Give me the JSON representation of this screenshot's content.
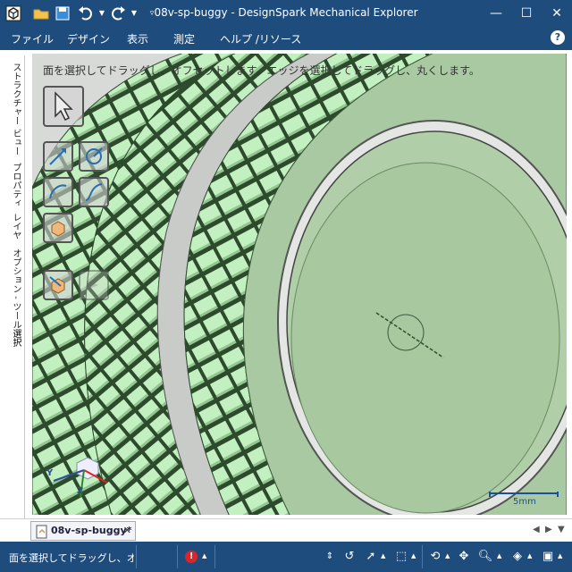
{
  "window": {
    "title": "08v-sp-buggy - DesignSpark Mechanical Explorer",
    "minimize_glyph": "—",
    "maximize_glyph": "☐",
    "close_glyph": "✕"
  },
  "menu": {
    "items": [
      "ファイル",
      "デザイン",
      "表示",
      "測定",
      "ヘルプ /リソース"
    ],
    "help_glyph": "?"
  },
  "side_panel": {
    "tabs": [
      "ストラクチャー",
      "ビュー",
      "プロパティ",
      "レイヤ",
      "オプション - ツール",
      "選択"
    ]
  },
  "viewport": {
    "hint": "面を選択してドラッグし、オフセットします。エッジを選択してドラッグし、丸くします。",
    "scale_label": "5mm",
    "axes": {
      "y": "Y",
      "z": "Z"
    },
    "colors": {
      "tread": "#c3f0c0",
      "tread_edge": "#3a5a3a",
      "hub": "#a8c8a0",
      "rim": "#e4e6e4"
    }
  },
  "document_tabs": [
    {
      "label": "08v-sp-buggy*",
      "close_glyph": "✕"
    }
  ],
  "doc_nav": {
    "left": "◀",
    "right": "▶",
    "menu": "▼"
  },
  "status": {
    "message": "面を選択してドラッグし、オ",
    "error_glyph": "!"
  }
}
